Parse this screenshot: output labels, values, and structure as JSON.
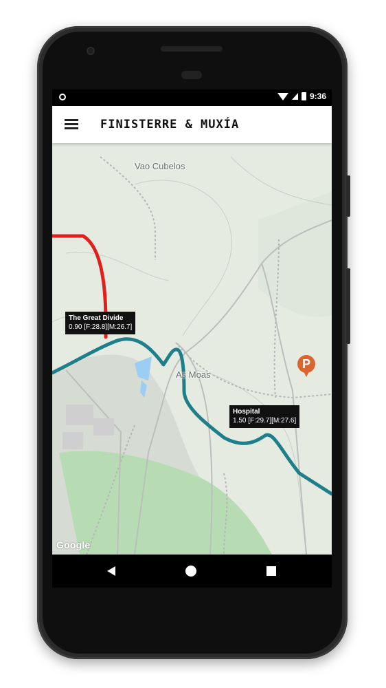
{
  "status_bar": {
    "time": "9:36",
    "left_icon": "circle-notification-icon",
    "right_icons": [
      "wifi-icon",
      "signal-icon",
      "battery-icon"
    ]
  },
  "app_bar": {
    "title": "FINISTERRE & MUXÍA",
    "menu_icon": "hamburger-menu-icon"
  },
  "map": {
    "place_labels": [
      "Vao Cubelos",
      "As Moas"
    ],
    "markers": [
      {
        "title": "The Great Divide",
        "detail": "0.90 [F:28.8][M:26.7]"
      },
      {
        "title": "Hospital",
        "detail": "1.50 [F:29.7][M:27.6]"
      }
    ],
    "parking_label": "P",
    "attribution": "Google",
    "colors": {
      "route_finisterre": "#1e7f8a",
      "route_muxia": "#e0201c",
      "parking": "#d9662e",
      "forest": "#b7dcb3",
      "water": "#9ccdf2",
      "land": "#e6ebe2"
    }
  },
  "nav_bar": {
    "back_icon": "back-triangle-icon",
    "home_icon": "home-circle-icon",
    "recents_icon": "recents-square-icon"
  }
}
